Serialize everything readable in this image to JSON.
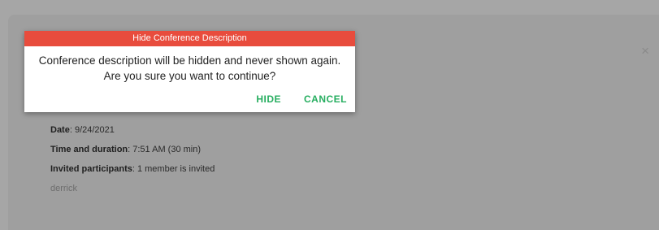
{
  "dialog": {
    "title": "Hide Conference Description",
    "message_line1": "Conference description will be hidden and never shown again.",
    "message_line2": "Are you sure you want to continue?",
    "hide_label": "HIDE",
    "cancel_label": "CANCEL"
  },
  "close_glyph": "×",
  "details": {
    "date_label": "Date",
    "date_value": ": 9/24/2021",
    "time_label": "Time and duration",
    "time_value": ": 7:51 AM (30 min)",
    "participants_label": "Invited participants",
    "participants_value": ": 1 member is invited",
    "participant_name": "derrick"
  },
  "colors": {
    "dialog_header": "#e84c3d",
    "action_button": "#27ae60",
    "overlay": "#a6a6a6"
  }
}
